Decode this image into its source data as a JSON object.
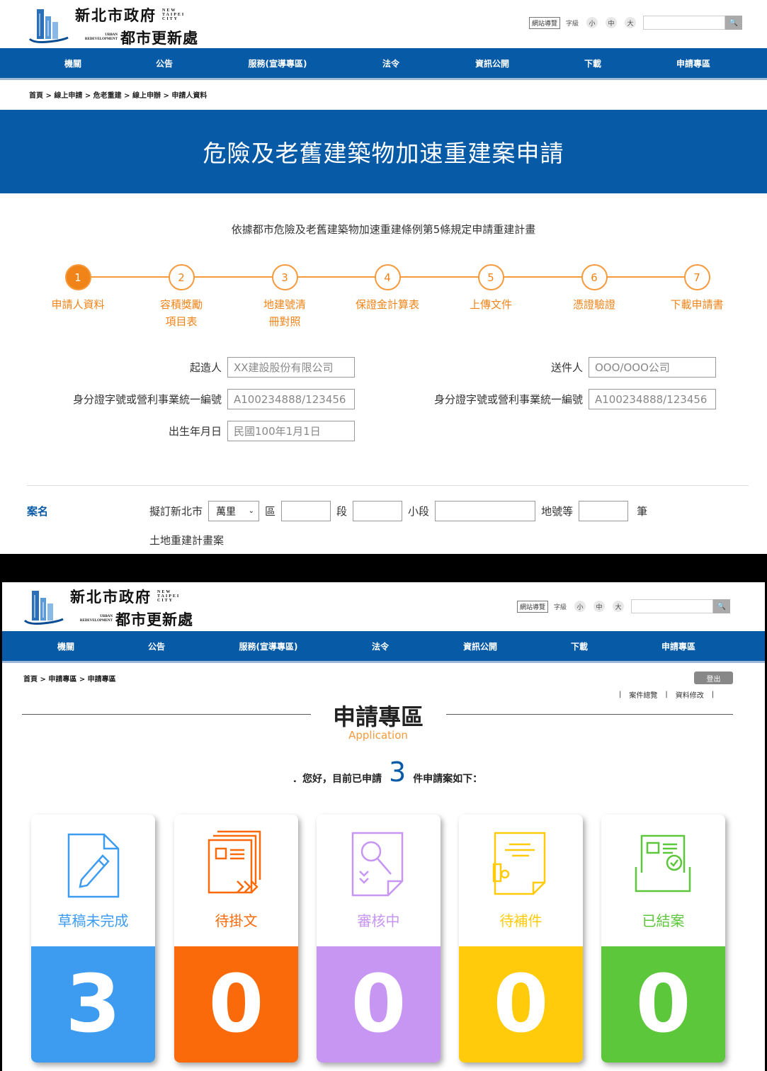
{
  "common": {
    "logo": {
      "cn_line1": "新北市政府",
      "en_line1": "NEW TAIPEI CITY",
      "en_line2": "URBAN REDEVELOPMENT",
      "cn_line2": "都市更新處"
    },
    "utility": {
      "sitemap": "網站導覽",
      "font_label": "字級",
      "font_small": "小",
      "font_medium": "中",
      "font_large": "大",
      "search_icon": "search-icon"
    },
    "nav": [
      "機關",
      "公告",
      "服務(宣導專區)",
      "法令",
      "資訊公開",
      "下載",
      "申請專區"
    ],
    "brand_color": "#075aa5",
    "accent_color": "#f08419"
  },
  "screen1": {
    "breadcrumb": "首頁 > 線上申請 > 危老重建 > 線上申辦 > 申請人資料",
    "banner_title": "危險及老舊建築物加速重建案申請",
    "intro": "依據都市危險及老舊建築物加速重建條例第5條規定申請重建計畫",
    "steps": [
      {
        "num": "1",
        "label_l1": "申請人資料",
        "label_l2": ""
      },
      {
        "num": "2",
        "label_l1": "容積獎勵",
        "label_l2": "項目表"
      },
      {
        "num": "3",
        "label_l1": "地建號清",
        "label_l2": "冊對照"
      },
      {
        "num": "4",
        "label_l1": "保證金計算表",
        "label_l2": ""
      },
      {
        "num": "5",
        "label_l1": "上傳文件",
        "label_l2": ""
      },
      {
        "num": "6",
        "label_l1": "憑證驗證",
        "label_l2": ""
      },
      {
        "num": "7",
        "label_l1": "下載申請書",
        "label_l2": ""
      }
    ],
    "active_step": 1,
    "form": {
      "builder_label": "起造人",
      "builder_value": "XX建設股份有限公司",
      "sender_label": "送件人",
      "sender_value": "OOO/OOO公司",
      "id_label_left": "身分證字號或營利事業統一編號",
      "id_value_left": "A100234888/123456",
      "id_label_right": "身分證字號或營利事業統一編號",
      "id_value_right": "A100234888/123456",
      "birth_label": "出生年月日",
      "birth_value": "民國100年1月1日"
    },
    "case": {
      "label": "案名",
      "prefix": "擬訂新北市",
      "district_select": "萬里",
      "district_suffix": "區",
      "section_suffix": "段",
      "subsection_label": "小段",
      "lot_suffix": "地號等",
      "count_suffix": "筆",
      "plan_suffix": "土地重建計畫案"
    }
  },
  "screen2": {
    "breadcrumb": "首頁 > 申請專區 > 申請專區",
    "logout": "登出",
    "links": [
      "案件總覽",
      "資料修改"
    ],
    "title": "申請專區",
    "subtitle": "Application",
    "greeting_prefix": "．您好，目前已申請",
    "greeting_count": "3",
    "greeting_suffix": "件申請案如下：",
    "cards": [
      {
        "label": "草稿未完成",
        "count": "3",
        "color": "#3d9cf0",
        "icon": "draft-edit-icon"
      },
      {
        "label": "待掛文",
        "count": "0",
        "color": "#fa6a0a",
        "icon": "pending-document-icon"
      },
      {
        "label": "審核中",
        "count": "0",
        "color": "#c795f2",
        "icon": "review-search-icon"
      },
      {
        "label": "待補件",
        "count": "0",
        "color": "#ffcb0a",
        "icon": "supplement-document-icon"
      },
      {
        "label": "已結案",
        "count": "0",
        "color": "#5cc73a",
        "icon": "closed-case-icon"
      }
    ]
  }
}
